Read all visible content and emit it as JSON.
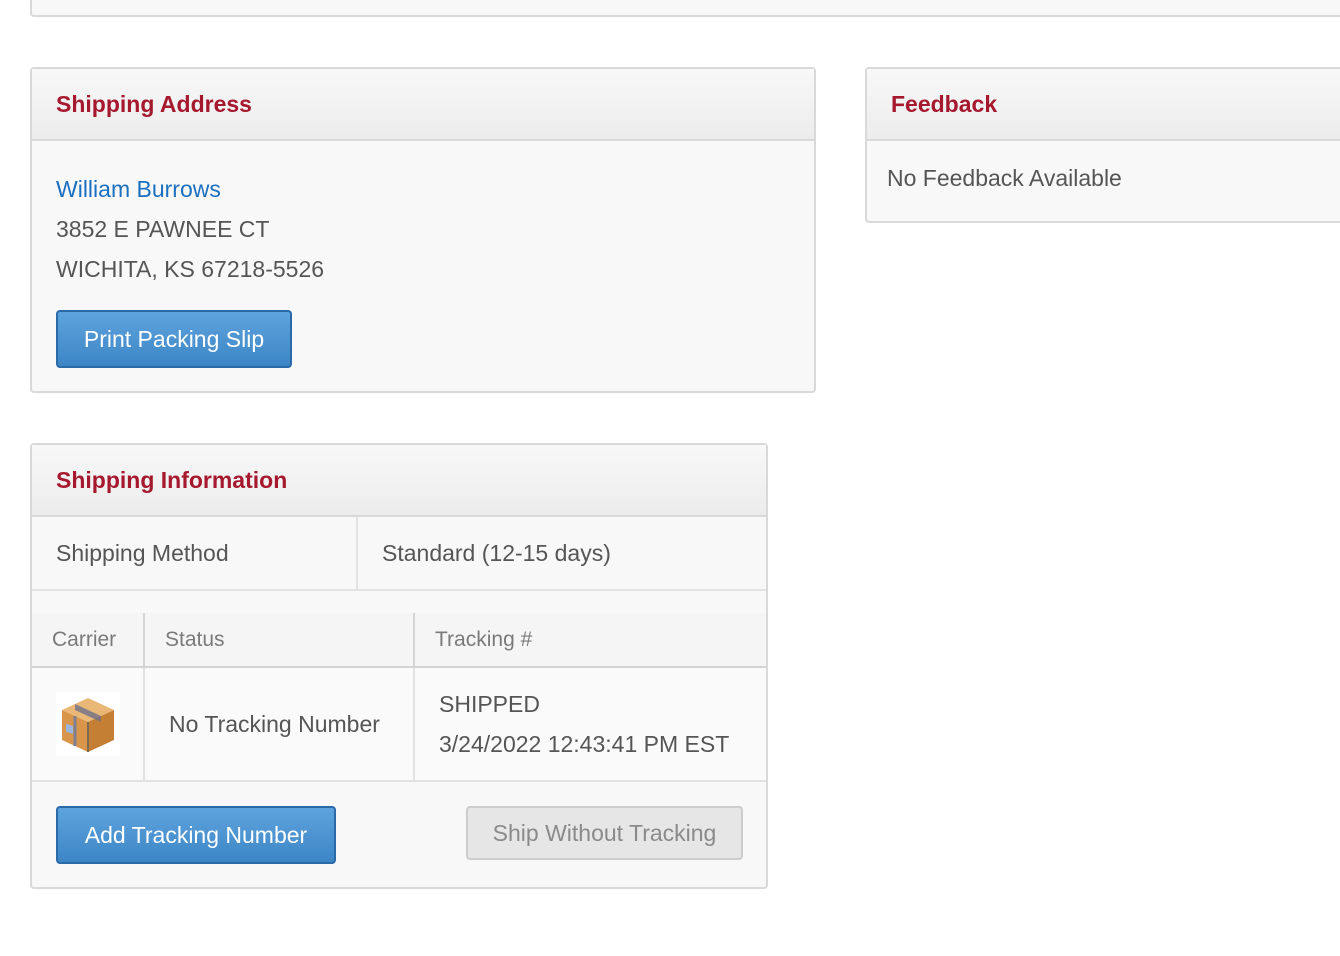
{
  "shipping_address": {
    "title": "Shipping Address",
    "name": "William Burrows",
    "street": "3852 E PAWNEE CT",
    "city_state_zip": "WICHITA, KS 67218-5526",
    "print_button": "Print Packing Slip"
  },
  "feedback": {
    "title": "Feedback",
    "message": "No Feedback Available"
  },
  "shipping_info": {
    "title": "Shipping Information",
    "method_label": "Shipping Method",
    "method_value": "Standard (12-15 days)",
    "columns": [
      "Carrier",
      "Status",
      "Tracking #"
    ],
    "row": {
      "carrier_icon": "package-icon",
      "status": "No Tracking Number",
      "tracking_line1": "SHIPPED",
      "tracking_line2": "3/24/2022 12:43:41 PM EST"
    },
    "add_tracking_button": "Add Tracking Number",
    "ship_without_button": "Ship Without Tracking"
  },
  "colors": {
    "heading": "#a6182e",
    "link": "#1a6fc1",
    "primary_button": "#3c86c6"
  }
}
